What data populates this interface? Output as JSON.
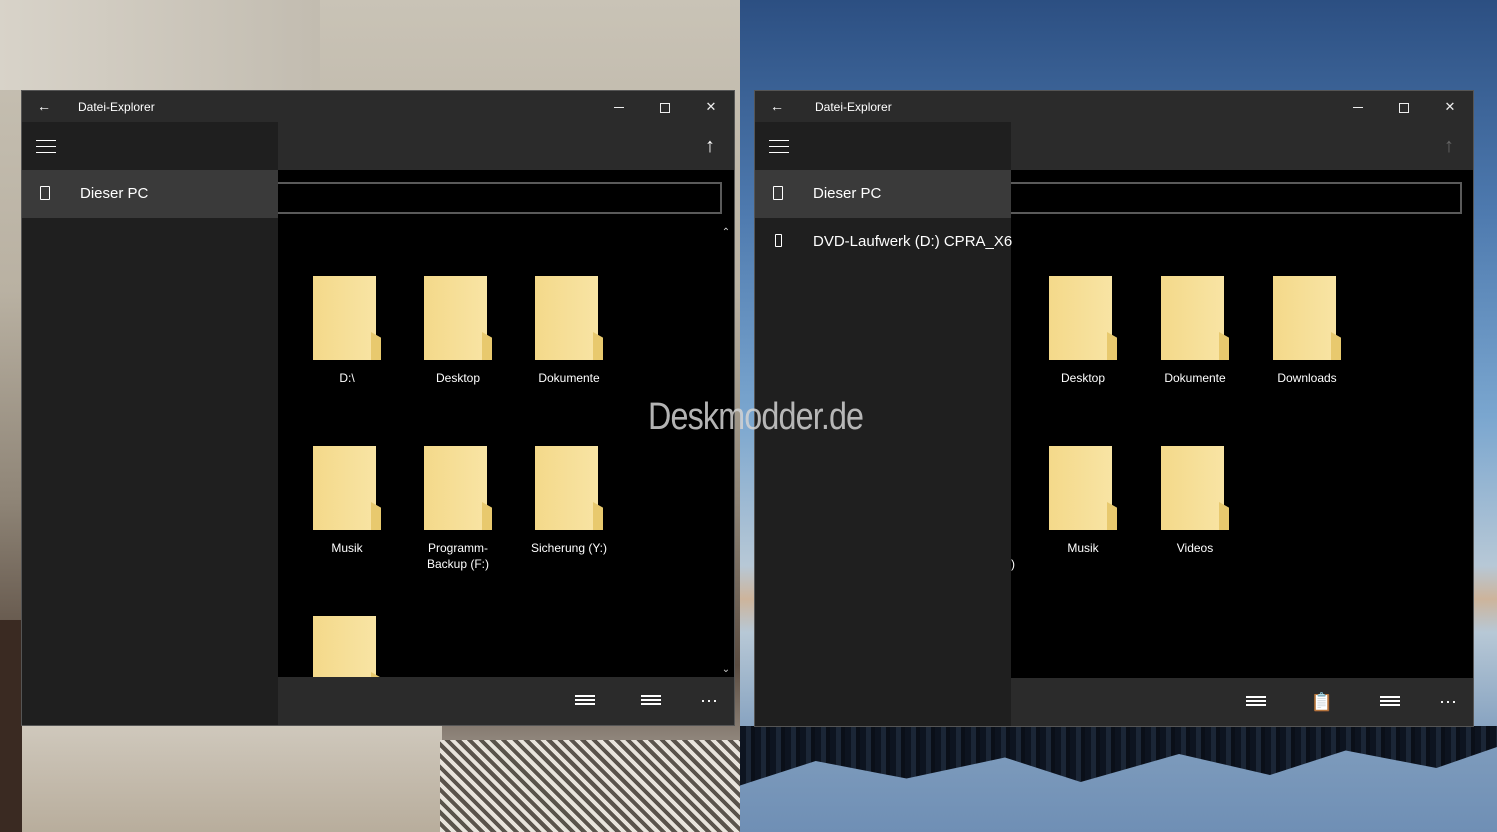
{
  "watermark": "Deskmodder.de",
  "left_window": {
    "title": "Datei-Explorer",
    "nav_items": [
      {
        "label": "Dieser PC",
        "icon": "device-icon",
        "selected": true
      }
    ],
    "folders": [
      {
        "label": "D:\\"
      },
      {
        "label": "Desktop"
      },
      {
        "label": "Dokumente"
      },
      {
        "label": "Musik"
      },
      {
        "label": "Programm-Backup (F:)"
      },
      {
        "label": "Sicherung (Y:)"
      },
      {
        "label": ""
      }
    ]
  },
  "right_window": {
    "title": "Datei-Explorer",
    "nav_items": [
      {
        "label": "Dieser PC",
        "icon": "device-icon",
        "selected": true
      },
      {
        "label": "DVD-Laufwerk (D:) CPRA_X6",
        "icon": "usb-drive-icon",
        "selected": false
      }
    ],
    "folders": [
      {
        "label": "Desktop"
      },
      {
        "label": "Dokumente"
      },
      {
        "label": "Downloads"
      },
      {
        "label": "Musik"
      },
      {
        "label": "Videos"
      }
    ],
    "partial_text": ")"
  },
  "icons": {
    "back": "back-arrow-icon",
    "minimize": "minimize-icon",
    "maximize": "maximize-icon",
    "close": "close-icon",
    "menu": "hamburger-menu-icon",
    "up": "up-arrow-icon",
    "select": "select-mode-icon",
    "paste": "paste-icon",
    "list": "list-view-icon",
    "more": "more-icon"
  }
}
